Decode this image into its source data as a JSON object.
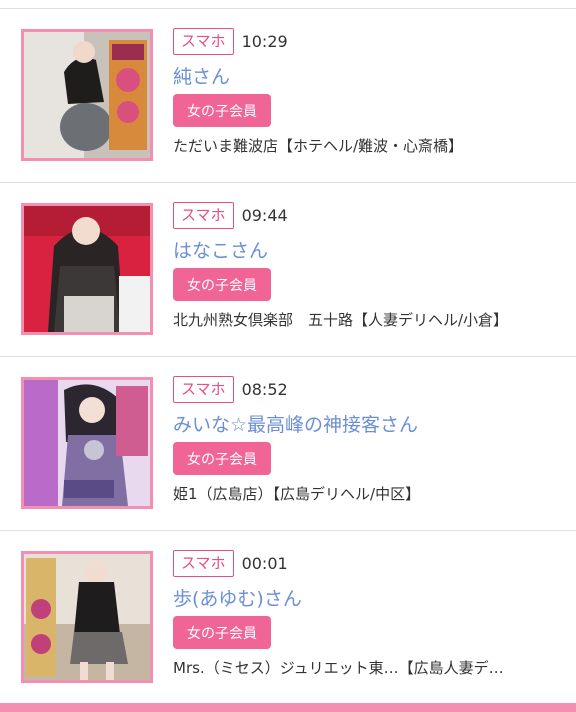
{
  "colors": {
    "accent": "#e54f88",
    "name_link": "#6b8fd6",
    "member_badge_bg": "#f06595",
    "thumb_border": "#f48fb1"
  },
  "items": [
    {
      "device": "スマホ",
      "time": "10:29",
      "name": "純さん",
      "member": "女の子会員",
      "shop": "ただいま難波店【ホテヘル/難波・心斎橋】"
    },
    {
      "device": "スマホ",
      "time": "09:44",
      "name": "はなこさん",
      "member": "女の子会員",
      "shop": "北九州熟女倶楽部　五十路【人妻デリヘル/小倉】"
    },
    {
      "device": "スマホ",
      "time": "08:52",
      "name": "みいな☆最高峰の神接客さん",
      "member": "女の子会員",
      "shop": "姫1（広島店）【広島デリヘル/中区】"
    },
    {
      "device": "スマホ",
      "time": "00:01",
      "name": "歩(あゆむ)さん",
      "member": "女の子会員",
      "shop": "Mrs.（ミセス）ジュリエット東…【広島人妻デ…"
    }
  ]
}
